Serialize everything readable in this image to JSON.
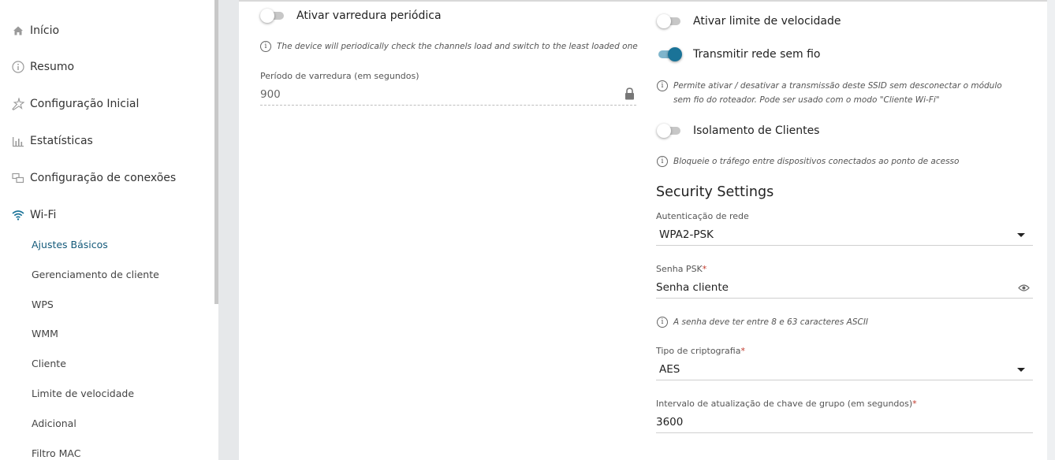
{
  "sidebar": {
    "items": [
      {
        "label": "Início",
        "icon": "home-icon"
      },
      {
        "label": "Resumo",
        "icon": "info-icon"
      },
      {
        "label": "Configuração Inicial",
        "icon": "wand-icon"
      },
      {
        "label": "Estatísticas",
        "icon": "stats-icon"
      },
      {
        "label": "Configuração de conexões",
        "icon": "connections-icon"
      },
      {
        "label": "Wi-Fi",
        "icon": "wifi-icon"
      }
    ],
    "subitems": [
      {
        "label": "Ajustes Básicos",
        "active": true
      },
      {
        "label": "Gerenciamento de cliente"
      },
      {
        "label": "WPS"
      },
      {
        "label": "WMM"
      },
      {
        "label": "Cliente"
      },
      {
        "label": "Limite de velocidade"
      },
      {
        "label": "Adicional"
      },
      {
        "label": "Filtro MAC"
      }
    ]
  },
  "left_panel": {
    "periodic_scan_label": "Ativar varredura periódica",
    "periodic_scan_on": false,
    "periodic_scan_hint": "The device will periodically check the channels load and switch to the least loaded one",
    "scan_period_label": "Período de varredura (em segundos)",
    "scan_period_value": "900"
  },
  "right_panel": {
    "speed_limit_label": "Ativar limite de velocidade",
    "speed_limit_on": false,
    "broadcast_label": "Transmitir rede sem fio",
    "broadcast_on": true,
    "broadcast_hint": "Permite ativar / desativar a transmissão deste SSID sem desconectar o módulo sem fio do roteador. Pode ser usado com o modo \"Cliente Wi-Fi\"",
    "isolation_label": "Isolamento de Clientes",
    "isolation_on": false,
    "isolation_hint": "Bloqueie o tráfego entre dispositivos conectados ao ponto de acesso",
    "security_title": "Security Settings",
    "auth_label": "Autenticação de rede",
    "auth_value": "WPA2-PSK",
    "psk_label": "Senha PSK",
    "psk_value": "Senha cliente",
    "psk_hint": "A senha deve ter entre 8 e 63 caracteres ASCII",
    "crypto_label": "Tipo de criptografia",
    "crypto_value": "AES",
    "group_key_label": "Intervalo de atualização de chave de grupo (em segundos)",
    "group_key_value": "3600",
    "required_mark": "*"
  },
  "colors": {
    "accent": "#1a7398",
    "active_nav": "#145a7a",
    "required": "#c0392b"
  }
}
